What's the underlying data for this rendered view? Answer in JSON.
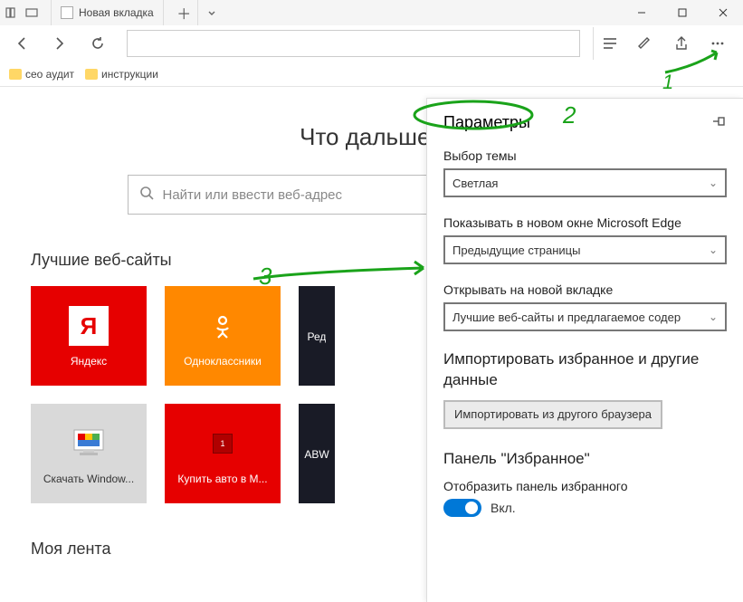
{
  "titlebar": {
    "tab_title": "Новая вкладка"
  },
  "bookmarks": {
    "items": [
      {
        "label": "сео аудит"
      },
      {
        "label": "инструкции"
      }
    ]
  },
  "content": {
    "heading": "Что дальше?",
    "search_placeholder": "Найти или ввести веб-адрес",
    "topsites_title": "Лучшие веб-сайты",
    "tiles_row1": [
      {
        "label": "Яндекс"
      },
      {
        "label": "Одноклассники"
      },
      {
        "label": "Ред"
      }
    ],
    "tiles_row2": [
      {
        "label": "Скачать Window..."
      },
      {
        "label": "Купить авто в М..."
      },
      {
        "label": "ABW"
      }
    ],
    "feed_title": "Моя лента"
  },
  "settings": {
    "title": "Параметры",
    "theme_label": "Выбор темы",
    "theme_value": "Светлая",
    "startup_label": "Показывать в новом окне Microsoft Edge",
    "startup_value": "Предыдущие страницы",
    "newtab_label": "Открывать на новой вкладке",
    "newtab_value": "Лучшие веб-сайты и предлагаемое содер",
    "import_heading": "Импортировать избранное и другие данные",
    "import_button": "Импортировать из другого браузера",
    "favbar_heading": "Панель \"Избранное\"",
    "favbar_toggle_label": "Отобразить панель избранного",
    "favbar_toggle_state": "Вкл."
  },
  "annotations": {
    "num1": "1",
    "num2": "2",
    "num3": "3"
  }
}
